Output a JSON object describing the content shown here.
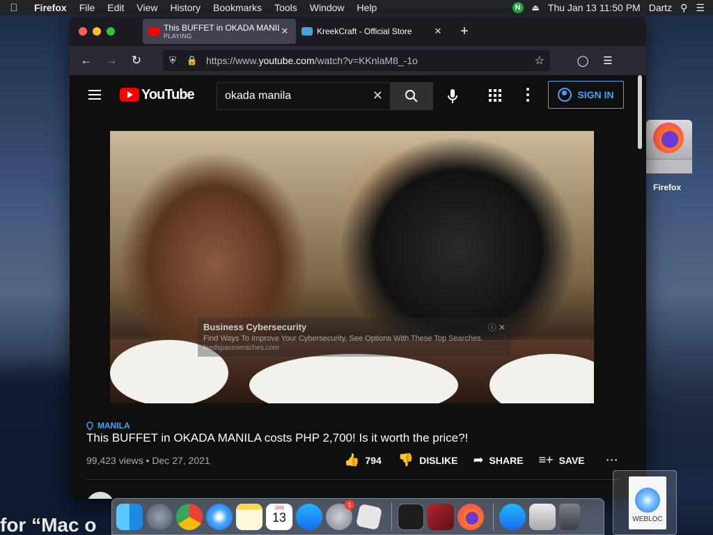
{
  "menubar": {
    "apple_icon": "apple-logo-icon",
    "items": [
      "Firefox",
      "File",
      "Edit",
      "View",
      "History",
      "Bookmarks",
      "Tools",
      "Window",
      "Help"
    ],
    "right": {
      "n_badge": "N",
      "clock": "Thu Jan 13  11:50 PM",
      "user": "Dartz"
    }
  },
  "browser": {
    "tabs": [
      {
        "title": "This BUFFET in OKADA MANILA",
        "subtitle": "PLAYING",
        "favicon_color": "#ff0000"
      },
      {
        "title": "KreekCraft - Official Store",
        "subtitle": "",
        "favicon_color": "#4aa3d8"
      }
    ],
    "url": {
      "prefix": "https://www.",
      "domain": "youtube.com",
      "suffix": "/watch?v=KKnlaM8_-1o"
    }
  },
  "youtube": {
    "logo_text": "YouTube",
    "search_value": "okada manila",
    "sign_in": "SIGN IN",
    "ad": {
      "title": "Business Cybersecurity",
      "text": "Find Ways To Improve Your Cybersecurity. See Options With These Top Searches.",
      "domain": "feedspaceseraches.com"
    },
    "location": "MANILA",
    "video_title": "This BUFFET in OKADA MANILA costs PHP 2,700! Is it worth the price?!",
    "views": "99,423 views",
    "date": "Dec 27, 2021",
    "likes": "794",
    "dislike": "DISLIKE",
    "share": "SHARE",
    "save": "SAVE"
  },
  "desktop": {
    "firefox_label": "Firefox",
    "webloc_label": "WEBLOC",
    "background_text": "for “Mac o"
  },
  "dock": {
    "apps": [
      "finder",
      "launchpad",
      "chrome",
      "safari",
      "notes",
      "calendar",
      "app-store",
      "system-preferences",
      "roblox",
      "terminal",
      "photo-booth",
      "firefox",
      "app-store-2",
      "preview",
      "trash"
    ],
    "calendar_month": "JAN",
    "calendar_day": "13",
    "sysprefs_badge": "1"
  },
  "colors": {
    "accent_blue": "#3ea6ff",
    "youtube_red": "#ff0000",
    "page_bg": "#0f0f0f"
  }
}
